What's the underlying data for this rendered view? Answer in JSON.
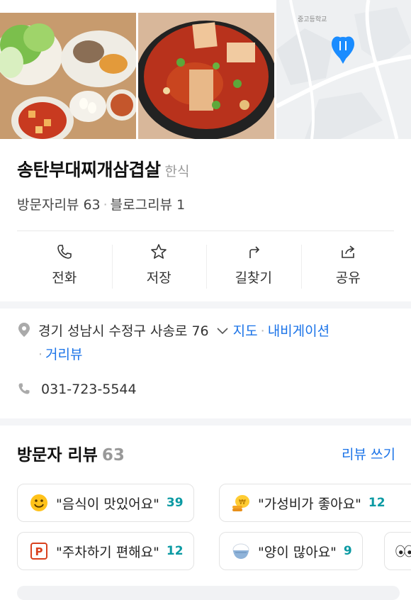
{
  "place": {
    "name": "송탄부대찌개삼겹살",
    "category": "한식",
    "visitor_review_label": "방문자리뷰 63",
    "blog_review_label": "블로그리뷰 1"
  },
  "map": {
    "label": "중고등학교"
  },
  "actions": {
    "call": "전화",
    "save": "저장",
    "directions": "길찾기",
    "share": "공유"
  },
  "address": {
    "text": "경기 성남시 수정구 사송로 76",
    "map_link": "지도",
    "navigation_link": "내비게이션",
    "street_view_link": "거리뷰"
  },
  "phone": "031-723-5544",
  "reviews": {
    "title": "방문자 리뷰",
    "count": "63",
    "write_label": "리뷰 쓰기",
    "chips": [
      {
        "text": "\"음식이 맛있어요\"",
        "count": "39",
        "icon": "smile-emoji-icon"
      },
      {
        "text": "\"가성비가 좋아요\"",
        "count": "12",
        "icon": "coin-icon"
      },
      {
        "text": "\"주차하기 편해요\"",
        "count": "12",
        "icon": "parking-icon"
      },
      {
        "text": "\"양이 많아요\"",
        "count": "9",
        "icon": "rice-bowl-icon"
      }
    ]
  },
  "colors": {
    "accent": "#1a73e8",
    "count_teal": "#0b9aa3",
    "map_pin": "#1a8cff"
  }
}
